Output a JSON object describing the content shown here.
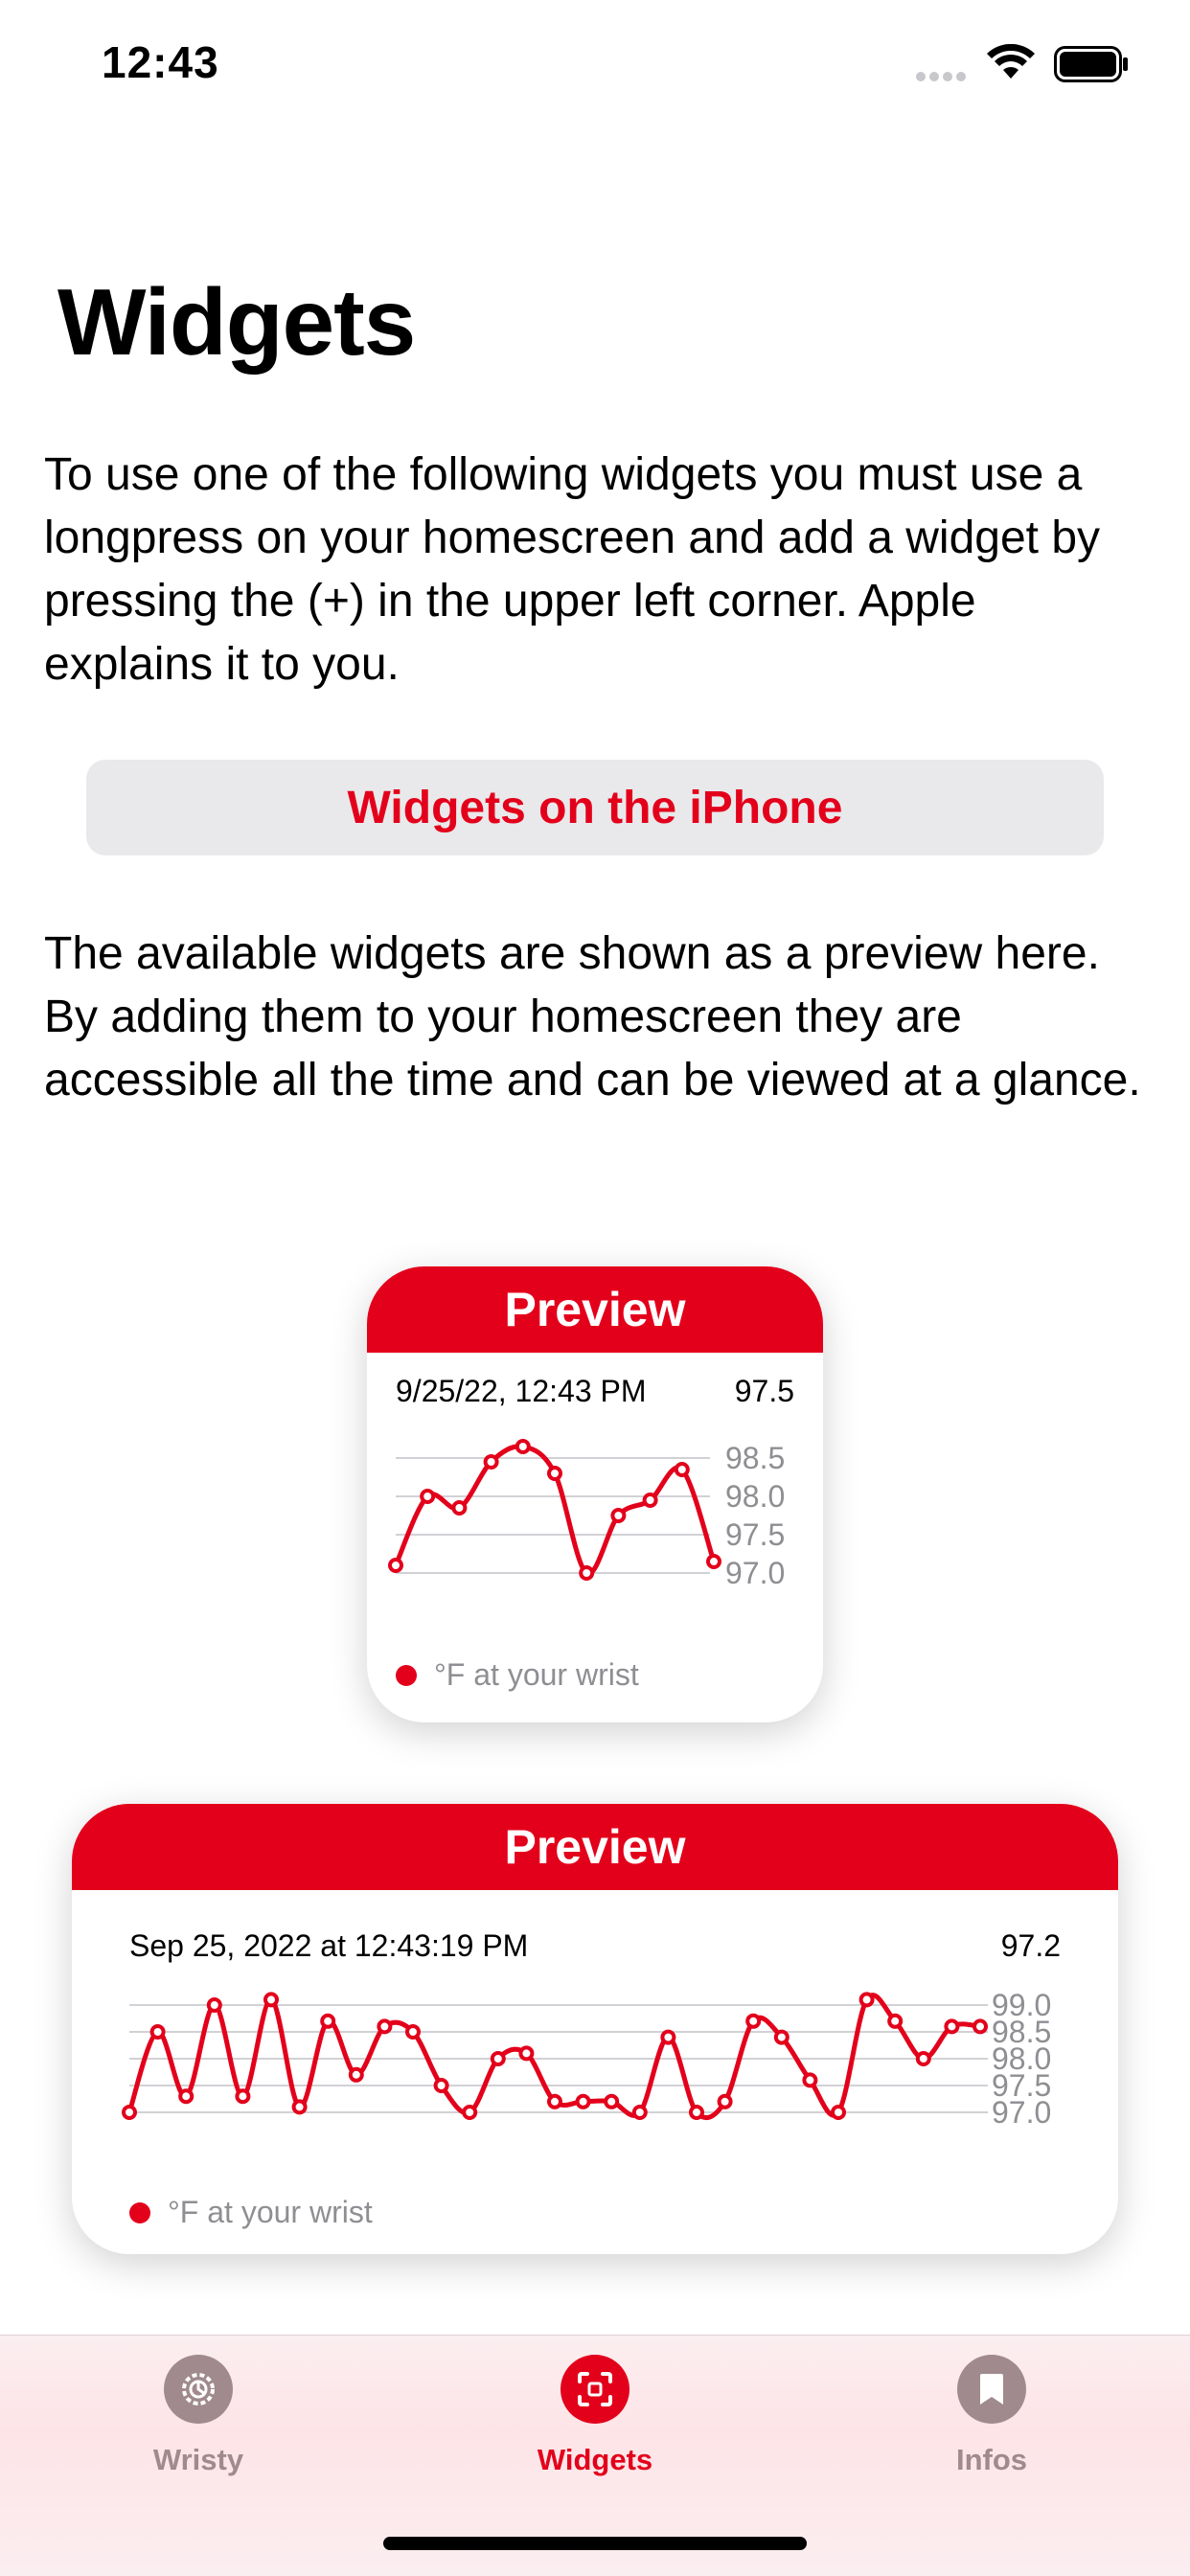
{
  "status": {
    "time": "12:43"
  },
  "page": {
    "title": "Widgets",
    "intro": "To use one of the following widgets you must use a longpress on your homescreen and add a widget by pressing the (+) in the upper left corner. Apple explains it to you.",
    "link_button": "Widgets on the iPhone",
    "description": "The available widgets are shown as a preview here. By adding them to your homescreen they are accessible all the time and can be viewed at a glance."
  },
  "colors": {
    "accent": "#e3001b",
    "inactive": "#a08a8e",
    "grid": "#d1d1d6"
  },
  "widgets": [
    {
      "header": "Preview",
      "date": "9/25/22, 12:43 PM",
      "current": "97.5",
      "legend": "°F at your wrist"
    },
    {
      "header": "Preview",
      "date": "Sep 25, 2022 at 12:43:19 PM",
      "current": "97.2",
      "legend": "°F at your wrist"
    }
  ],
  "chart_data": [
    {
      "type": "line",
      "title": "",
      "x": [
        1,
        2,
        3,
        4,
        5,
        6,
        7,
        8,
        9,
        10,
        11
      ],
      "series": [
        {
          "name": "°F at your wrist",
          "values": [
            97.1,
            98.0,
            97.85,
            98.45,
            98.65,
            98.3,
            97.0,
            97.75,
            97.95,
            98.35,
            97.15
          ]
        }
      ],
      "yticks": [
        "98.5",
        "98.0",
        "97.5",
        "97.0"
      ],
      "ylim": [
        97.0,
        98.5
      ],
      "grid": true,
      "legend": "bottom-left"
    },
    {
      "type": "line",
      "title": "",
      "x": [
        1,
        2,
        3,
        4,
        5,
        6,
        7,
        8,
        9,
        10,
        11,
        12,
        13,
        14,
        15,
        16,
        17,
        18,
        19,
        20,
        21,
        22,
        23,
        24,
        25,
        26,
        27,
        28,
        29,
        30,
        31
      ],
      "series": [
        {
          "name": "°F at your wrist",
          "values": [
            97.0,
            98.5,
            97.3,
            99.0,
            97.3,
            99.1,
            97.1,
            98.7,
            97.7,
            98.6,
            98.5,
            97.5,
            97.0,
            98.0,
            98.1,
            97.2,
            97.2,
            97.2,
            97.0,
            98.4,
            97.0,
            97.2,
            98.7,
            98.4,
            97.6,
            97.0,
            99.1,
            98.7,
            98.0,
            98.6,
            98.6
          ]
        }
      ],
      "yticks": [
        "99.0",
        "98.5",
        "98.0",
        "97.5",
        "97.0"
      ],
      "ylim": [
        97.0,
        99.0
      ],
      "grid": true,
      "legend": "bottom-left"
    }
  ],
  "tabs": [
    {
      "label": "Wristy",
      "icon": "gear-icon",
      "active": false
    },
    {
      "label": "Widgets",
      "icon": "widget-frame-icon",
      "active": true
    },
    {
      "label": "Infos",
      "icon": "bookmark-icon",
      "active": false
    }
  ]
}
